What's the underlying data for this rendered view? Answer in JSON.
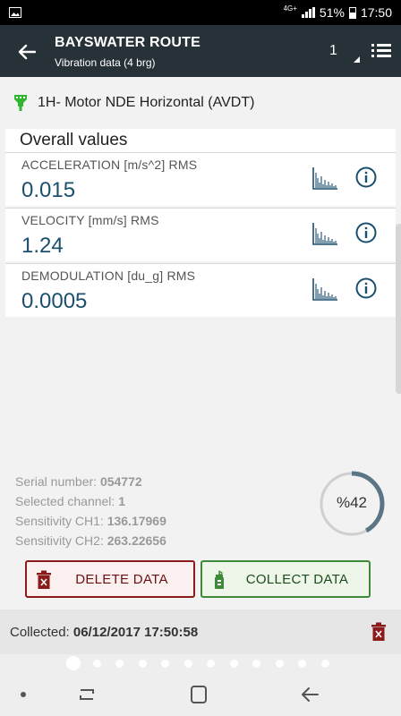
{
  "status_bar": {
    "network_type": "4G+",
    "battery_percent": "51%",
    "time": "17:50",
    "icons": [
      "image-icon",
      "signal-icon",
      "battery-icon"
    ]
  },
  "app_bar": {
    "title": "BAYSWATER ROUTE",
    "subtitle": "Vibration data (4 brg)",
    "bearing_number": "1",
    "icons": [
      "back-arrow-icon",
      "caret-icon",
      "list-menu-icon"
    ]
  },
  "measurement_point": {
    "name": "1H- Motor NDE Horizontal (AVDT)",
    "icon": "sensor-icon",
    "icon_color": "#2fb52f"
  },
  "overall": {
    "title": "Overall values",
    "items": [
      {
        "label": "ACCELERATION [m/s^2] RMS",
        "value": "0.015"
      },
      {
        "label": "VELOCITY [mm/s] RMS",
        "value": "1.24"
      },
      {
        "label": "DEMODULATION [du_g] RMS",
        "value": "0.0005"
      }
    ],
    "item_icons": [
      "spectrum-chart-icon",
      "info-icon"
    ]
  },
  "device_info": {
    "serial_label": "Serial number:",
    "serial_value": "054772",
    "channel_label": "Selected channel:",
    "channel_value": "1",
    "sens1_label": "Sensitivity CH1:",
    "sens1_value": "136.17969",
    "sens2_label": "Sensitivity CH2:",
    "sens2_value": "263.22656"
  },
  "progress": {
    "text": "%42",
    "fraction": 0.42,
    "track_color": "#cfcfcf",
    "fill_color": "#5b7486"
  },
  "actions": {
    "delete_label": "DELETE DATA",
    "collect_label": "COLLECT DATA",
    "delete_color": "#8b1b1b",
    "collect_color": "#3f8a3a"
  },
  "collected": {
    "label": "Collected:",
    "value": "06/12/2017 17:50:58"
  },
  "pager": {
    "page_count": 12,
    "active_index": 0
  },
  "colors": {
    "app_bar": "#263238",
    "value_text": "#1b4f6e"
  }
}
